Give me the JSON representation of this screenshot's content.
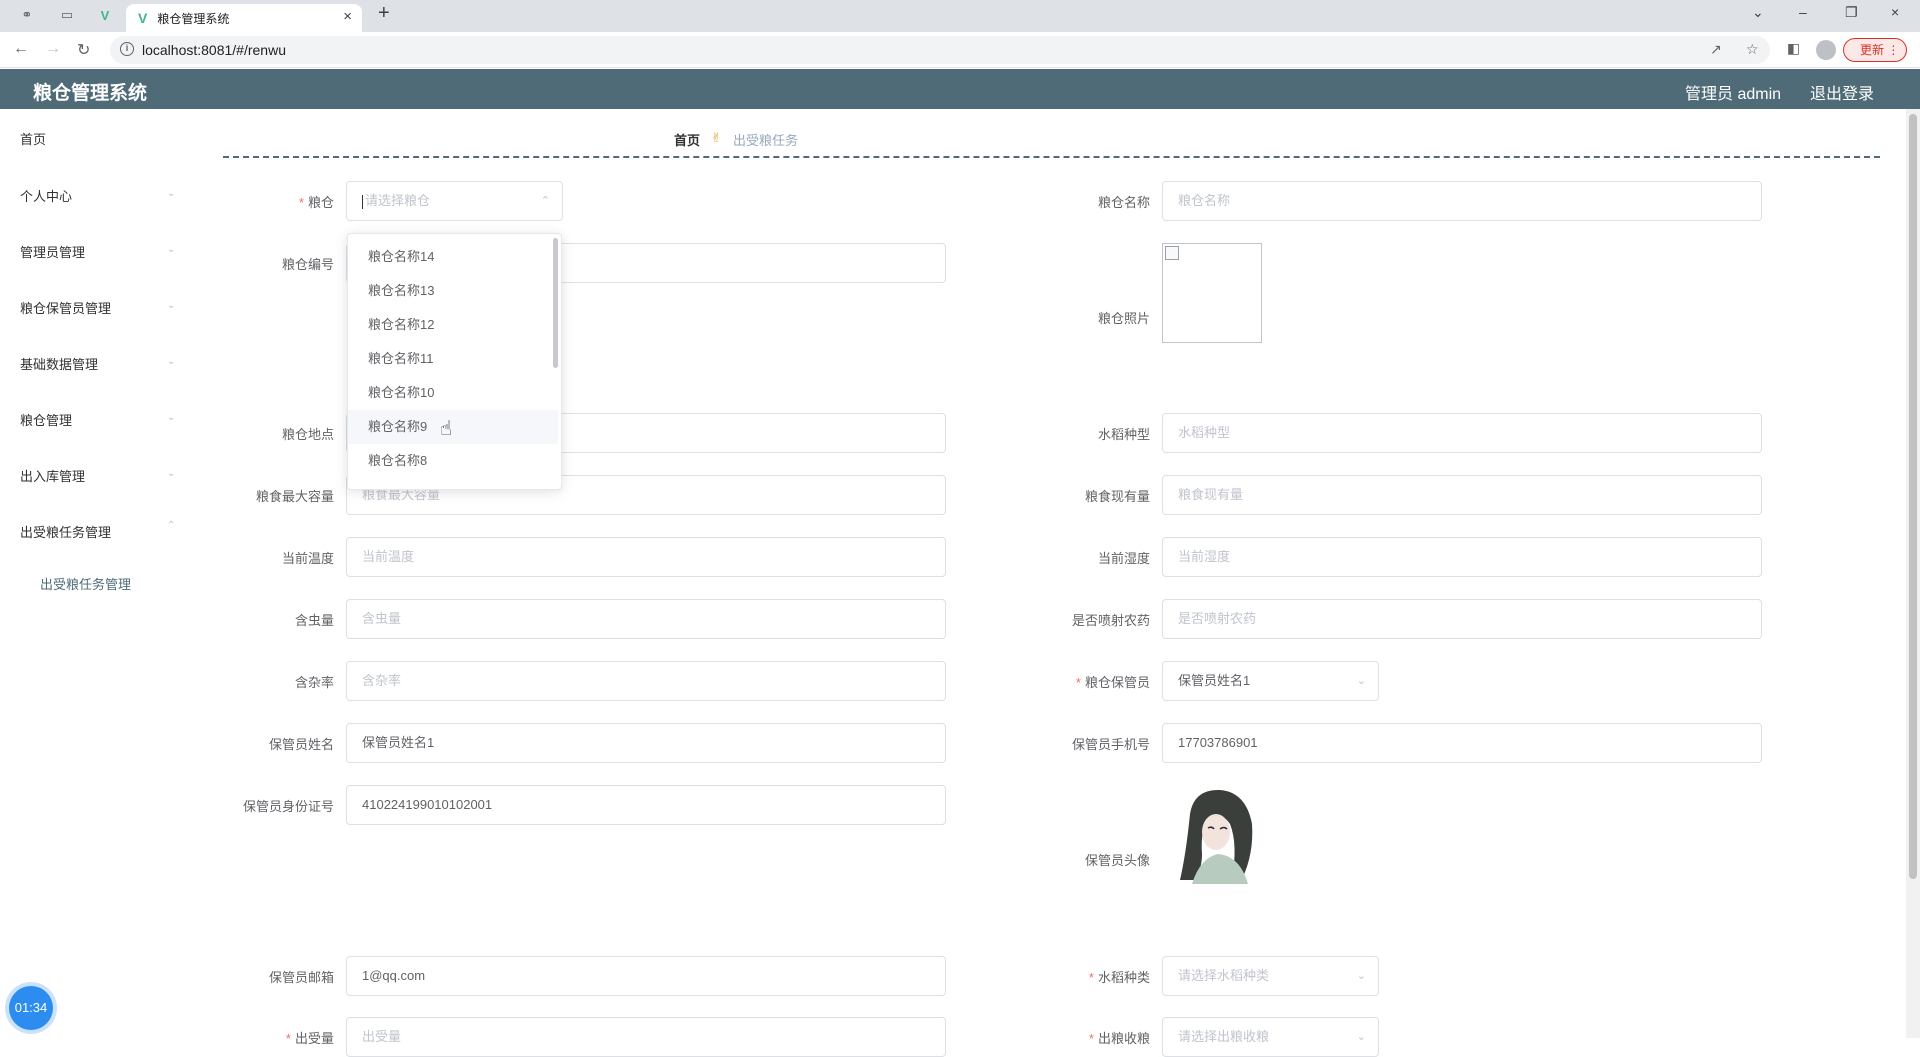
{
  "browser": {
    "tab_title": "粮仓管理系统",
    "url": "localhost:8081/#/renwu",
    "update_label": "更新"
  },
  "header": {
    "title": "粮仓管理系统",
    "user": "管理员 admin",
    "logout": "退出登录"
  },
  "sidebar": {
    "items": [
      {
        "label": "首页"
      },
      {
        "label": "个人中心"
      },
      {
        "label": "管理员管理"
      },
      {
        "label": "粮仓保管员管理"
      },
      {
        "label": "基础数据管理"
      },
      {
        "label": "粮仓管理"
      },
      {
        "label": "出入库管理"
      },
      {
        "label": "出受粮任务管理"
      }
    ],
    "sub_item": "出受粮任务管理"
  },
  "breadcrumb": {
    "home": "首页",
    "current": "出受粮任务"
  },
  "form": {
    "liangcang": {
      "label": "粮仓",
      "placeholder": "请选择粮仓"
    },
    "liangcang_name": {
      "label": "粮仓名称",
      "placeholder": "粮仓名称"
    },
    "liangcang_code": {
      "label": "粮仓编号",
      "value": ""
    },
    "liangcang_photo": {
      "label": "粮仓照片"
    },
    "location": {
      "label": "粮仓地点",
      "value": ""
    },
    "rice_type_text": {
      "label": "水稻种型",
      "placeholder": "水稻种型"
    },
    "max_capacity": {
      "label": "粮食最大容量",
      "placeholder": "粮食最大容量"
    },
    "current_amount": {
      "label": "粮食现有量",
      "placeholder": "粮食现有量"
    },
    "temperature": {
      "label": "当前温度",
      "placeholder": "当前温度"
    },
    "humidity": {
      "label": "当前湿度",
      "placeholder": "当前湿度"
    },
    "insects": {
      "label": "含虫量",
      "placeholder": "含虫量"
    },
    "pesticide": {
      "label": "是否喷射农药",
      "placeholder": "是否喷射农药"
    },
    "impurity": {
      "label": "含杂率",
      "placeholder": "含杂率"
    },
    "keeper_select": {
      "label": "粮仓保管员",
      "value": "保管员姓名1"
    },
    "keeper_name": {
      "label": "保管员姓名",
      "value": "保管员姓名1"
    },
    "keeper_phone": {
      "label": "保管员手机号",
      "value": "17703786901"
    },
    "keeper_id": {
      "label": "保管员身份证号",
      "value": "410224199010102001"
    },
    "keeper_avatar": {
      "label": "保管员头像"
    },
    "keeper_email": {
      "label": "保管员邮箱",
      "value": "1@qq.com"
    },
    "rice_kind": {
      "label": "水稻种类",
      "placeholder": "请选择水稻种类"
    },
    "out_amount": {
      "label": "出受量",
      "placeholder": "出受量"
    },
    "out_type": {
      "label": "出粮收粮",
      "placeholder": "请选择出粮收粮"
    }
  },
  "dropdown": {
    "options": [
      "粮仓名称14",
      "粮仓名称13",
      "粮仓名称12",
      "粮仓名称11",
      "粮仓名称10",
      "粮仓名称9",
      "粮仓名称8"
    ],
    "hovered_index": 5
  },
  "timer": "01:34",
  "colors": {
    "header_bg": "#4e6b77",
    "required": "#f56c6c",
    "timer_bg": "#2d8cf0"
  }
}
